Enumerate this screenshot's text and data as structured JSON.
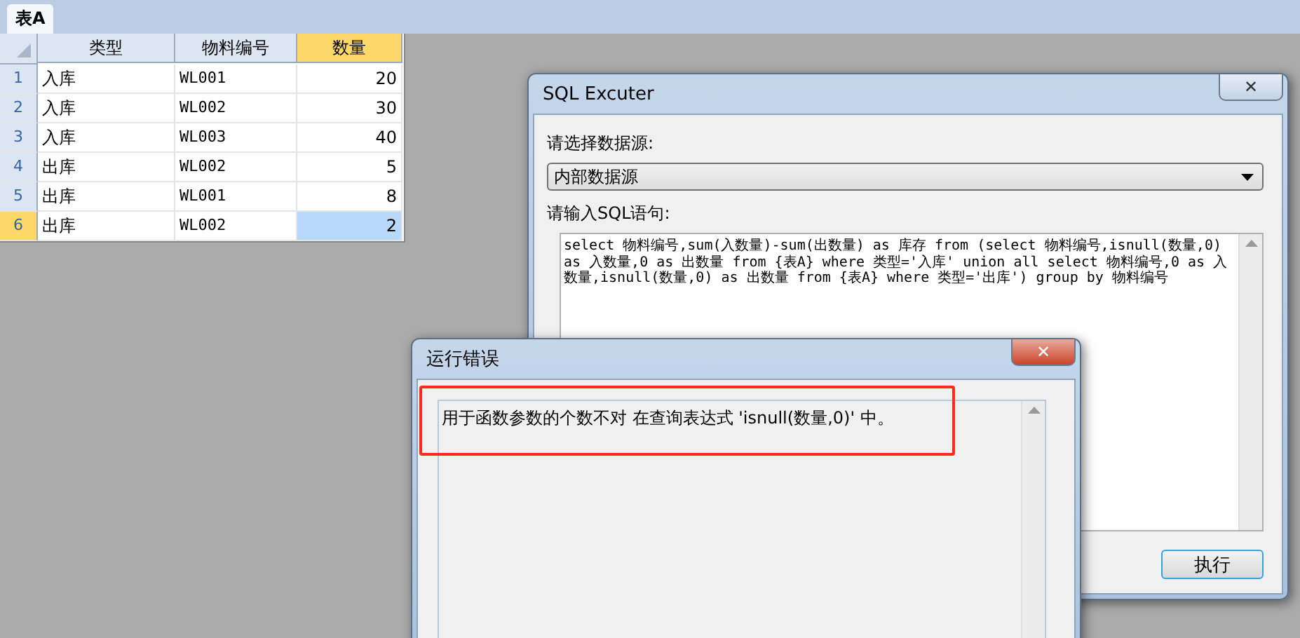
{
  "tabs": [
    {
      "label": "表A",
      "selected": true
    }
  ],
  "table": {
    "columns": [
      {
        "label": "类型",
        "selected": false,
        "kind": "text"
      },
      {
        "label": "物料编号",
        "selected": false,
        "kind": "code"
      },
      {
        "label": "数量",
        "selected": true,
        "kind": "number"
      }
    ],
    "rows": [
      {
        "number": "1",
        "selected": false,
        "cells": [
          "入库",
          "WL001",
          "20"
        ]
      },
      {
        "number": "2",
        "selected": false,
        "cells": [
          "入库",
          "WL002",
          "30"
        ]
      },
      {
        "number": "3",
        "selected": false,
        "cells": [
          "入库",
          "WL003",
          "40"
        ]
      },
      {
        "number": "4",
        "selected": false,
        "cells": [
          "出库",
          "WL002",
          "5"
        ]
      },
      {
        "number": "5",
        "selected": false,
        "cells": [
          "出库",
          "WL001",
          "8"
        ]
      },
      {
        "number": "6",
        "selected": true,
        "cells": [
          "出库",
          "WL002",
          "2"
        ]
      }
    ]
  },
  "sql_dialog": {
    "title": "SQL Excuter",
    "close": "✕",
    "source_label": "请选择数据源:",
    "source_value": "内部数据源",
    "sql_label": "请输入SQL语句:",
    "sql": "select 物料编号,sum(入数量)-sum(出数量) as 库存 from (select 物料编号,isnull(数量,0) as 入数量,0 as 出数量 from {表A} where 类型='入库' union all select 物料编号,0 as 入数量,isnull(数量,0) as 出数量 from {表A} where 类型='出库') group by 物料编号",
    "run_button": "执行"
  },
  "error_dialog": {
    "title": "运行错误",
    "close": "✕",
    "message": "用于函数参数的个数不对 在查询表达式 'isnull(数量,0)' 中。",
    "highlighted": true
  }
}
